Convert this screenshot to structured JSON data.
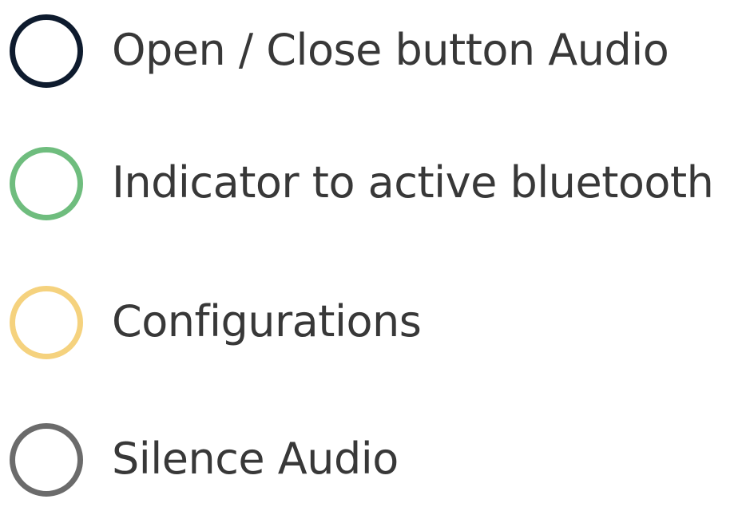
{
  "legend": {
    "items": [
      {
        "label": "Open / Close button Audio",
        "ring_color": "#0e1b2e",
        "icon": "dark-navy-ring-icon"
      },
      {
        "label": "Indicator to active bluetooth",
        "ring_color": "#6fbd7e",
        "icon": "green-ring-icon"
      },
      {
        "label": "Configurations",
        "ring_color": "#f5d27e",
        "icon": "yellow-ring-icon"
      },
      {
        "label": "Silence Audio",
        "ring_color": "#6b6b6b",
        "icon": "gray-ring-icon"
      }
    ]
  }
}
